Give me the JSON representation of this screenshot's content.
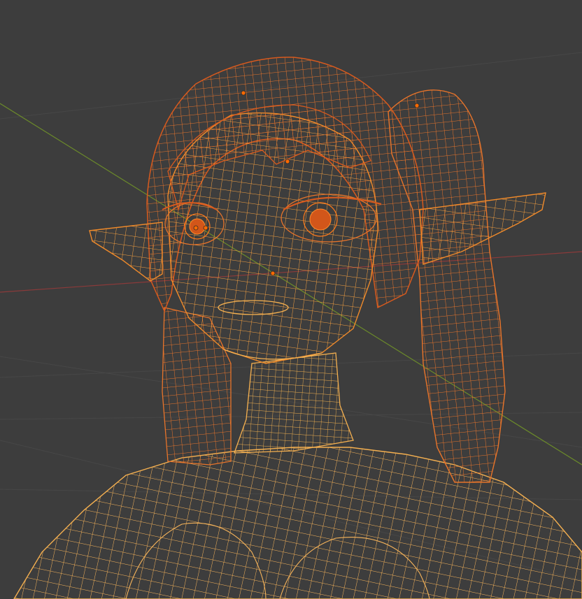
{
  "viewport": {
    "background": "#3d3d3d",
    "grid_color": "#4a4a4a",
    "x_axis_color": "#8a3a3a",
    "y_axis_color": "#6b8a2a",
    "wire_primary": "#f08a2a",
    "wire_light": "#f5b050",
    "wire_dark": "#c8501a",
    "vertex_color": "#ff6a00",
    "shading": "wireframe",
    "selected_objects": [
      "body",
      "head",
      "hair",
      "ear-left",
      "ear-right",
      "eye-left",
      "eye-right",
      "pigtail-left",
      "pigtail-right"
    ]
  }
}
